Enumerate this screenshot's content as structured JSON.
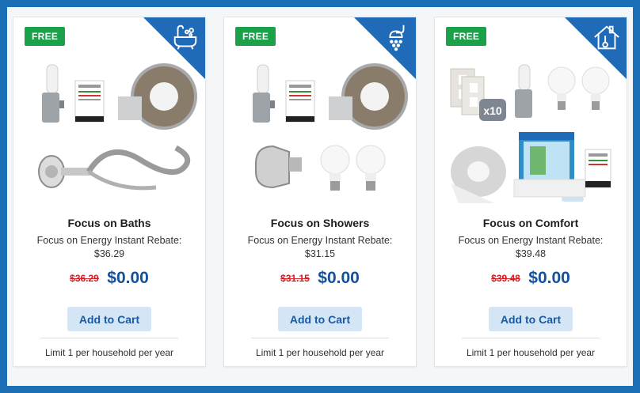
{
  "cards": [
    {
      "badge": "FREE",
      "corner_icon": "bathtub-icon",
      "title": "Focus on Baths",
      "rebate_label": "Focus on Energy Instant Rebate:",
      "rebate_amount": "$36.29",
      "old_price": "$36.29",
      "new_price": "$0.00",
      "button_label": "Add to Cart",
      "limit": "Limit 1 per household per year"
    },
    {
      "badge": "FREE",
      "corner_icon": "shower-icon",
      "title": "Focus on Showers",
      "rebate_label": "Focus on Energy Instant Rebate:",
      "rebate_amount": "$31.15",
      "old_price": "$31.15",
      "new_price": "$0.00",
      "button_label": "Add to Cart",
      "limit": "Limit 1 per household per year"
    },
    {
      "badge": "FREE",
      "corner_icon": "house-thermometer-icon",
      "title": "Focus on Comfort",
      "rebate_label": "Focus on Energy Instant Rebate:",
      "rebate_amount": "$39.48",
      "old_price": "$39.48",
      "new_price": "$0.00",
      "button_label": "Add to Cart",
      "limit": "Limit 1 per household per year",
      "art_badge": "x10"
    }
  ],
  "colors": {
    "badge_green": "#1aa14a",
    "corner_blue": "#1f6bb8",
    "old_price_red": "#d71920",
    "new_price_blue": "#15509c",
    "button_bg": "#d4e6f5"
  }
}
